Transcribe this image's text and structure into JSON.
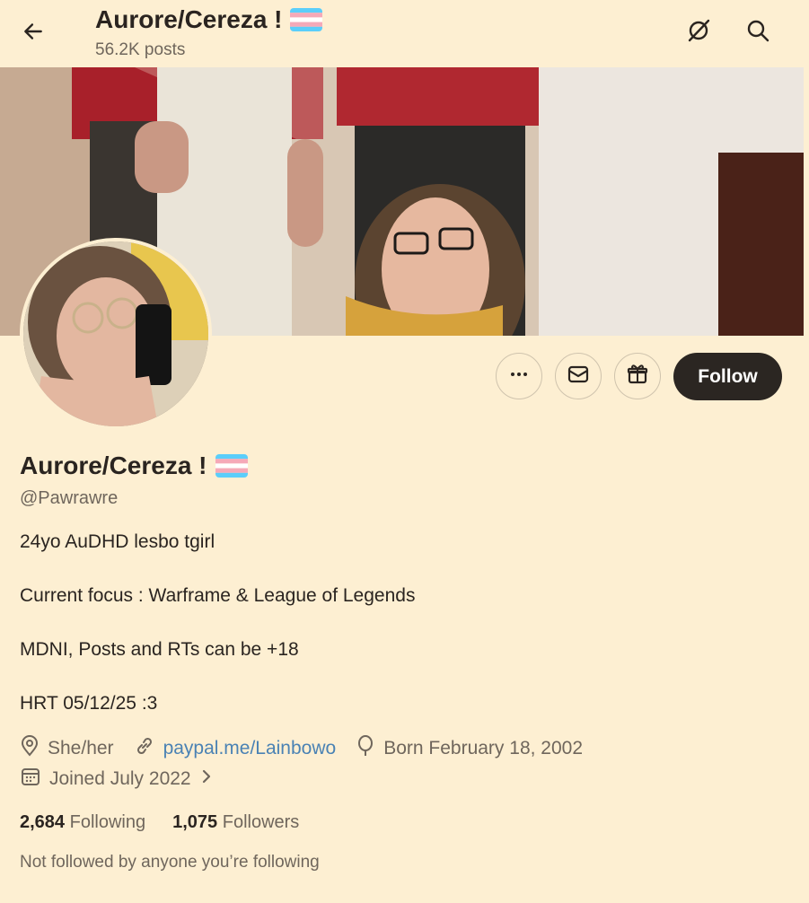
{
  "header": {
    "title": "Aurore/Cereza !",
    "post_count": "56.2K posts",
    "icons": [
      "back-arrow-icon",
      "grok-icon",
      "search-icon"
    ]
  },
  "profile": {
    "name": "Aurore/Cereza !",
    "handle": "@Pawrawre",
    "flag": "transgender-flag",
    "bio_lines": [
      "24yo AuDHD lesbo tgirl",
      "Current focus : Warframe & League of Legends",
      "MDNI, Posts and RTs can be +18",
      "HRT 05/12/25 :3"
    ],
    "pronouns": "She/her",
    "link": "paypal.me/Lainbowo",
    "birthday": "Born February 18, 2002",
    "joined": "Joined July 2022",
    "following_count": "2,684",
    "following_label": "Following",
    "followers_count": "1,075",
    "followers_label": "Followers",
    "followed_note": "Not followed by anyone you’re following"
  },
  "actions": {
    "follow_label": "Follow",
    "icons": [
      "more-icon",
      "message-icon",
      "gift-icon"
    ]
  },
  "colors": {
    "background": "#fdefd2",
    "text": "#2a2420",
    "muted": "#6f665c",
    "link": "#4a82b4",
    "follow_button": "#2b2622",
    "flag_blue": "#5bcefa",
    "flag_pink": "#f5a9b8"
  }
}
